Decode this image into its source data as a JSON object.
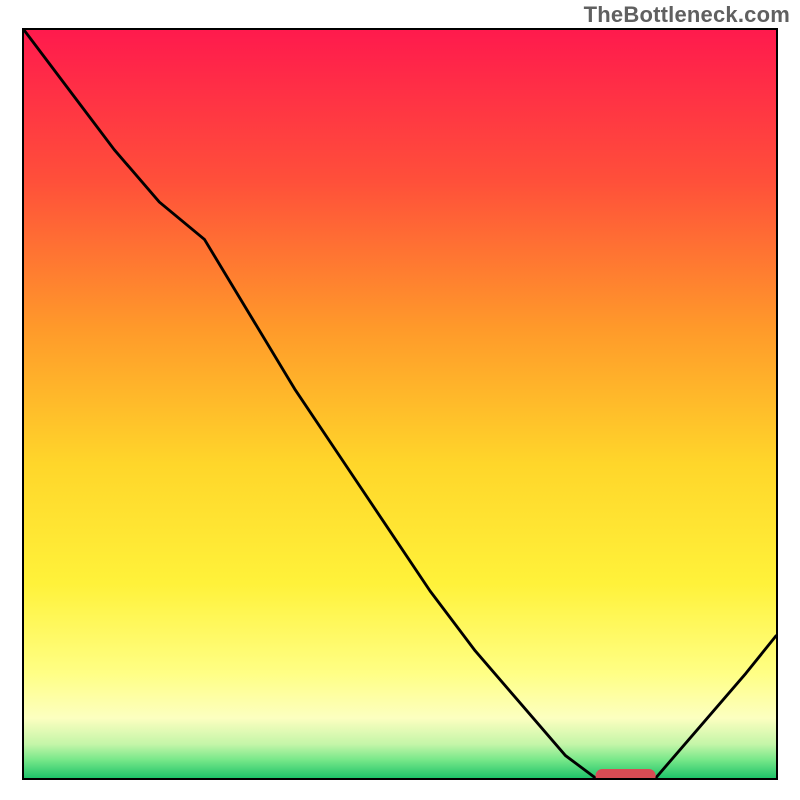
{
  "watermark": "TheBottleneck.com",
  "colors": {
    "curve": "#000000",
    "marker": "#d84c54",
    "border": "#000000"
  },
  "chart_data": {
    "type": "line",
    "title": "",
    "xlabel": "",
    "ylabel": "",
    "xlim": [
      0,
      100
    ],
    "ylim": [
      0,
      100
    ],
    "gradient_stops": [
      {
        "offset": 0.0,
        "color": "#ff1a4d"
      },
      {
        "offset": 0.2,
        "color": "#ff4f3a"
      },
      {
        "offset": 0.4,
        "color": "#ff9a2a"
      },
      {
        "offset": 0.58,
        "color": "#ffd62a"
      },
      {
        "offset": 0.74,
        "color": "#fff23a"
      },
      {
        "offset": 0.86,
        "color": "#ffff85"
      },
      {
        "offset": 0.92,
        "color": "#fcffc0"
      },
      {
        "offset": 0.955,
        "color": "#c4f5a8"
      },
      {
        "offset": 0.975,
        "color": "#7ae88a"
      },
      {
        "offset": 1.0,
        "color": "#1fc46a"
      }
    ],
    "series": [
      {
        "name": "bottleneck-curve",
        "x": [
          0,
          6,
          12,
          18,
          24,
          30,
          36,
          42,
          48,
          54,
          60,
          66,
          72,
          76,
          80,
          84,
          90,
          96,
          100
        ],
        "y": [
          100,
          92,
          84,
          77,
          72,
          62,
          52,
          43,
          34,
          25,
          17,
          10,
          3,
          0,
          0,
          0,
          7,
          14,
          19
        ]
      }
    ],
    "marker": {
      "name": "optimal-range",
      "x_start": 76,
      "x_end": 84,
      "y": 0
    }
  }
}
